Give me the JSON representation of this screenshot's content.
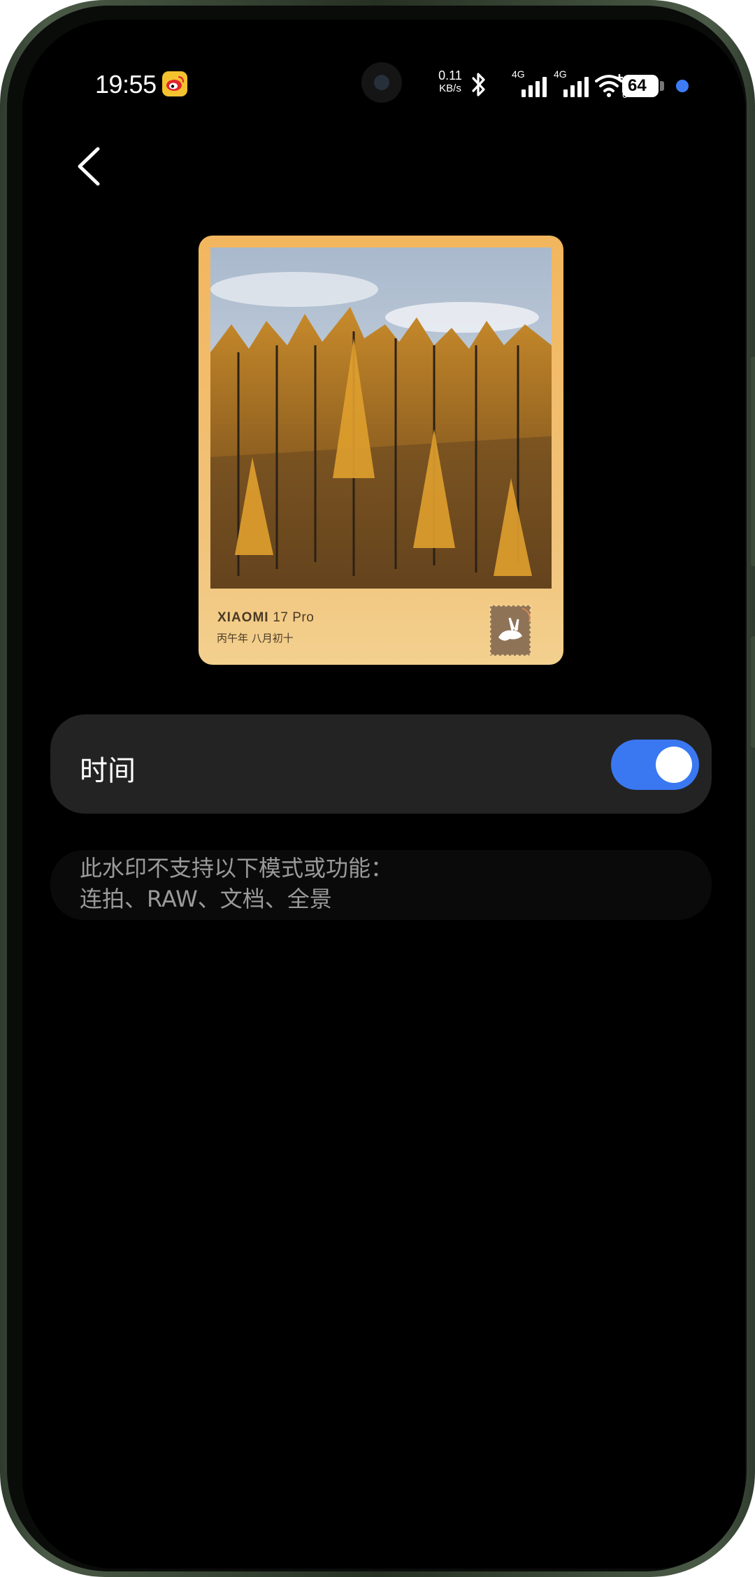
{
  "status_bar": {
    "time": "19:55",
    "net_speed_value": "0.11",
    "net_speed_unit": "KB/s",
    "signal1_label": "4G",
    "signal2_label": "4G",
    "wifi_label": "6",
    "battery_level": "64",
    "icons": [
      "weibo-icon",
      "bluetooth-icon",
      "signal-icon",
      "wifi-icon",
      "battery-icon"
    ]
  },
  "header": {
    "back_icon": "chevron-left-icon"
  },
  "preview": {
    "brand": "XIAOMI",
    "model": "17 Pro",
    "date": "丙午年 八月初十",
    "stamp_icon": "rabbit-stamp-icon"
  },
  "setting": {
    "label": "时间",
    "enabled": true
  },
  "notice": {
    "line1": "此水印不支持以下模式或功能：",
    "line2": "连拍、RAW、文档、全景"
  },
  "colors": {
    "accent": "#3a78f2",
    "row_bg": "#232323",
    "card_bg": "#f2b65e",
    "notice_text": "#9a9a9a"
  }
}
